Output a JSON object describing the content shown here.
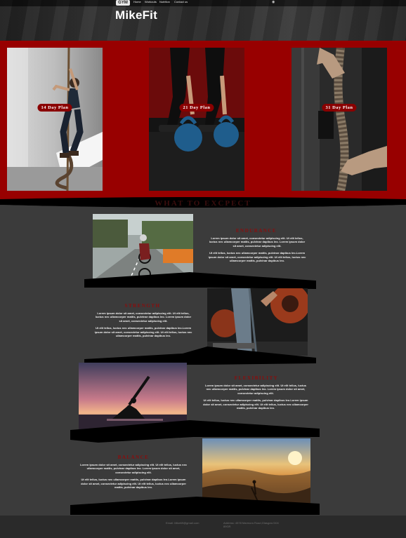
{
  "header": {
    "logo_text": "GYM",
    "brand": "MikeFit",
    "nav": [
      "Home",
      "Workouts",
      "Nutrition",
      "Contact us"
    ],
    "cart_icon": "cart-icon"
  },
  "plans": [
    {
      "label": "14 Day Plan"
    },
    {
      "label": "21 Day Plan"
    },
    {
      "label": "31 Day Plan"
    }
  ],
  "expect": {
    "title": "WHAT TO EXCPECT",
    "features": [
      {
        "title": "ENDURANCE",
        "p1": "Lorem ipsum dolor sit amet, consectetur adipiscing elit. Ut elit tellus, luctus nec ullamcorper mattis, pulvinar dapibus leo. Lorem ipsum dolor sit amet, consectetur adipiscing elit.",
        "p2": "Ut elit tellus, luctus nec ullamcorper mattis, pulvinar dapibus leo.Lorem ipsum dolor sit amet, consectetur adipiscing elit. Ut elit tellus, luctus nec ullamcorper mattis, pulvinar dapibus leo."
      },
      {
        "title": "STRENGTH",
        "p1": "Lorem ipsum dolor sit amet, consectetur adipiscing elit. Ut elit tellus, luctus nec ullamcorper mattis, pulvinar dapibus leo. Lorem ipsum dolor sit amet, consectetur adipiscing elit.",
        "p2": "Ut elit tellus, luctus nec ullamcorper mattis, pulvinar dapibus leo.Lorem ipsum dolor sit amet, consectetur adipiscing elit. Ut elit tellus, luctus nec ullamcorper mattis, pulvinar dapibus leo."
      },
      {
        "title": "FLEXIBILITY",
        "p1": "Lorem ipsum dolor sit amet, consectetur adipiscing elit. Ut elit tellus, luctus nec ullamcorper mattis, pulvinar dapibus leo. Lorem ipsum dolor sit amet, consectetur adipiscing elit.",
        "p2": "Ut elit tellus, luctus nec ullamcorper mattis, pulvinar dapibus leo.Lorem ipsum dolor sit amet, consectetur adipiscing elit. Ut elit tellus, luctus nec ullamcorper mattis, pulvinar dapibus leo."
      },
      {
        "title": "BALANCE",
        "p1": "Lorem ipsum dolor sit amet, consectetur adipiscing elit. Ut elit tellus, luctus nec ullamcorper mattis, pulvinar dapibus leo. Lorem ipsum dolor sit amet, consectetur adipiscing elit.",
        "p2": "Ut elit tellus, luctus nec ullamcorper mattis, pulvinar dapibus leo.Lorem ipsum dolor sit amet, consectetur adipiscing elit. Ut elit tellus, luctus nec ullamcorper mattis, pulvinar dapibus leo."
      }
    ]
  },
  "footer": {
    "email": "Email: Mike69@gmail.com",
    "address": "Address: 4578 Marmora Road,Glasgow D04 89GR"
  },
  "colors": {
    "red": "#980000",
    "accent_text": "#8b0d0d",
    "panel": "#3b3b3b"
  }
}
